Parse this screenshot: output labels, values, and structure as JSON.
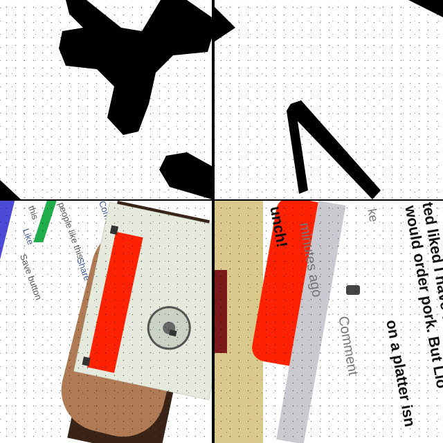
{
  "tile_top_right": {
    "glyph": "^"
  },
  "tile_bottom_left": {
    "lines": [
      "this",
      "Like",
      "Save button",
      "people like this",
      "Comment",
      "Share"
    ]
  },
  "tile_bottom_right": {
    "post_text": [
      "ted liked I have tried Lio",
      "would order pork. But Lio",
      "on a platter isn"
    ],
    "word_fragment": "unch!",
    "time_fragment": "minutes ago",
    "comment_label": "Comment",
    "like_fragment": "ke"
  },
  "colors": {
    "red": "#ff2200",
    "green": "#1fae4b",
    "blue": "#4b4bd8",
    "disk_body": "#e6eadc",
    "hand": "#b07a55"
  }
}
